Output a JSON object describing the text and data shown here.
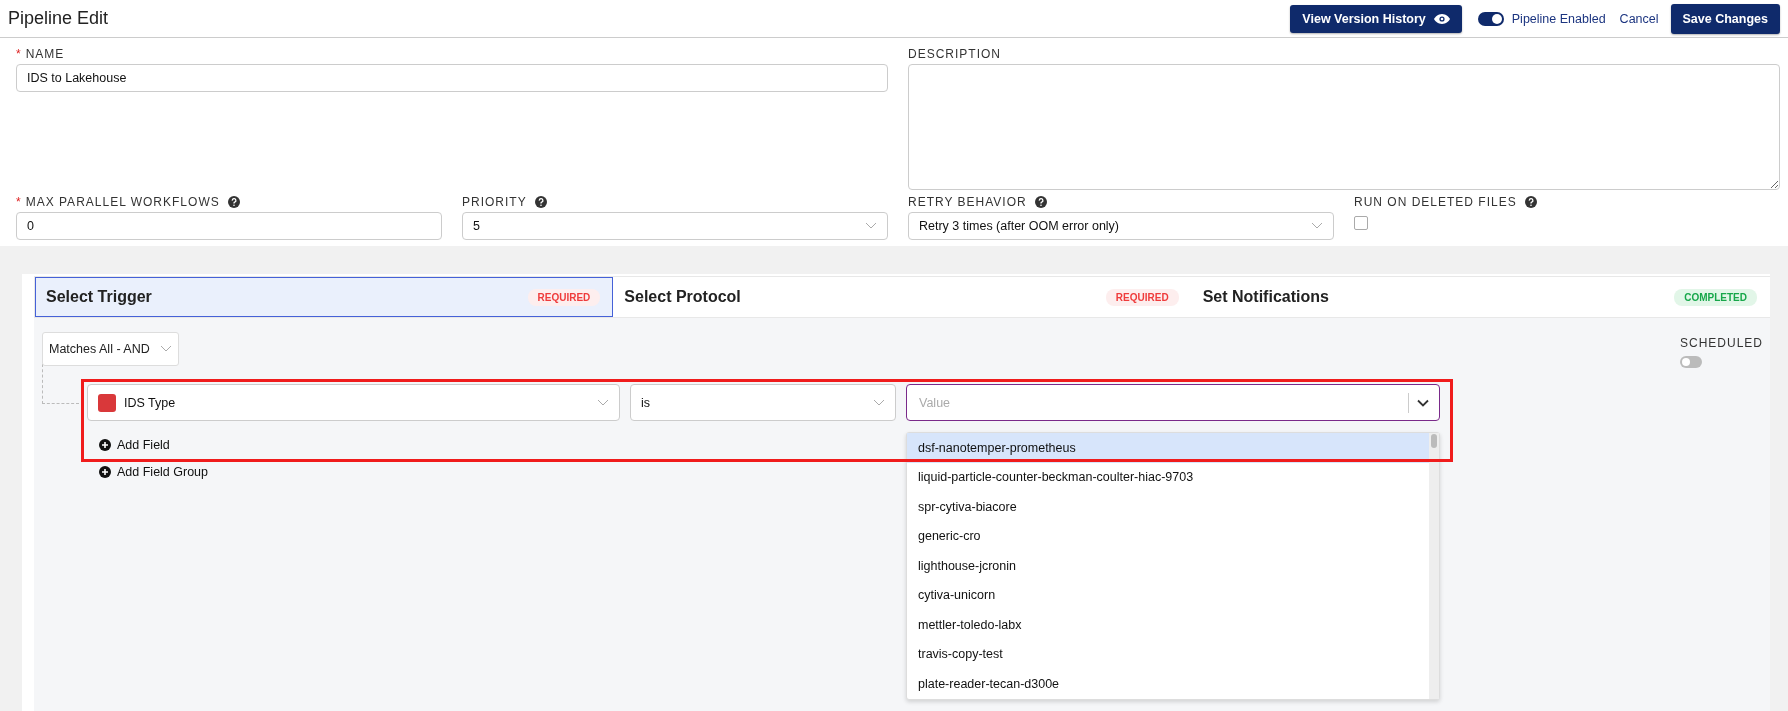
{
  "header": {
    "title": "Pipeline Edit",
    "history_button": "View Version History",
    "enabled_toggle": {
      "label": "Pipeline Enabled",
      "on": true
    },
    "cancel": "Cancel",
    "save": "Save Changes"
  },
  "form": {
    "name": {
      "required_mark": "*",
      "label": "NAME",
      "value": "IDS to Lakehouse"
    },
    "description": {
      "label": "DESCRIPTION"
    },
    "max_parallel": {
      "required_mark": "*",
      "label": "MAX PARALLEL WORKFLOWS",
      "help": true,
      "value": "0"
    },
    "priority": {
      "label": "PRIORITY",
      "help": true,
      "value": "5"
    },
    "retry": {
      "label": "RETRY BEHAVIOR",
      "help": true,
      "value": "Retry 3 times (after OOM error only)"
    },
    "run_on_deleted": {
      "label": "RUN ON DELETED FILES",
      "help": true,
      "checked": false
    }
  },
  "tabs": [
    {
      "label": "Select Trigger",
      "selected": true,
      "badge": {
        "kind": "required",
        "text": "REQUIRED"
      }
    },
    {
      "label": "Select Protocol",
      "selected": false,
      "badge": {
        "kind": "required",
        "text": "REQUIRED"
      }
    },
    {
      "label": "Set Notifications",
      "selected": false,
      "badge": {
        "kind": "completed",
        "text": "COMPLETED"
      }
    }
  ],
  "trigger": {
    "match": "Matches All - AND",
    "field": {
      "value": "IDS Type",
      "color": "#d9383a"
    },
    "operator": "is",
    "value_placeholder": "Value",
    "options": [
      {
        "label": "dsf-nanotemper-prometheus",
        "selected": true
      },
      {
        "label": "liquid-particle-counter-beckman-coulter-hiac-9703",
        "selected": false
      },
      {
        "label": "spr-cytiva-biacore",
        "selected": false
      },
      {
        "label": "generic-cro",
        "selected": false
      },
      {
        "label": "lighthouse-jcronin",
        "selected": false
      },
      {
        "label": "cytiva-unicorn",
        "selected": false
      },
      {
        "label": "mettler-toledo-labx",
        "selected": false
      },
      {
        "label": "travis-copy-test",
        "selected": false
      },
      {
        "label": "plate-reader-tecan-d300e",
        "selected": false
      }
    ],
    "add_field": "Add Field",
    "add_group": "Add Field Group",
    "scheduled": {
      "label": "SCHEDULED",
      "on": false
    }
  }
}
